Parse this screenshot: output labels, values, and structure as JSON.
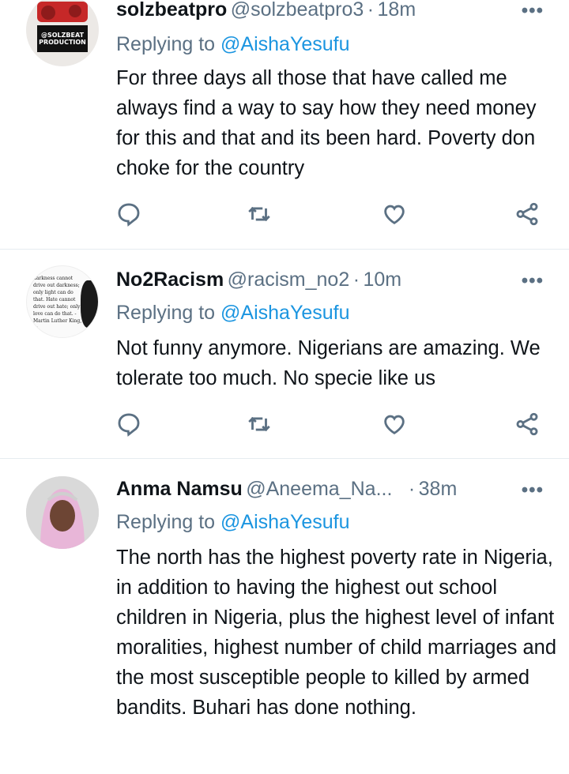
{
  "tweets": [
    {
      "display_name": "solzbeatpro",
      "handle": "@solzbeatpro3",
      "time": "18m",
      "replying_label": "Replying to",
      "replying_to": "@AishaYesufu",
      "text": "For three days all those that have called me always find a way to say how they need money for this and that and its been hard. Poverty don choke for the country",
      "avatar_text": "@SOLZBEAT PRODUCTION"
    },
    {
      "display_name": "No2Racism",
      "handle": "@racism_no2",
      "time": "10m",
      "replying_label": "Replying to",
      "replying_to": "@AishaYesufu",
      "text": "Not funny anymore. Nigerians are amazing. We tolerate too much. No specie like us",
      "avatar_text": "darkness cannot drive out darkness; only light can do that. Hate cannot drive out hate; only love can do that. -Martin Luther King, Jr."
    },
    {
      "display_name": "Anma Namsu",
      "handle": "@Aneema_Na...",
      "time": "38m",
      "replying_label": "Replying to",
      "replying_to": "@AishaYesufu",
      "text": "The north has the highest poverty rate in Nigeria, in addition to having the highest out school children in Nigeria, plus the highest level of infant moralities, highest number of child marriages and the most susceptible people to killed by armed bandits. Buhari has done nothing."
    }
  ],
  "separator": "·",
  "more_label": "•••",
  "icons": [
    "reply-icon",
    "retweet-icon",
    "like-icon",
    "share-icon"
  ],
  "colors": {
    "link": "#1b95e0",
    "muted": "#5b7083",
    "text": "#0f1419"
  }
}
